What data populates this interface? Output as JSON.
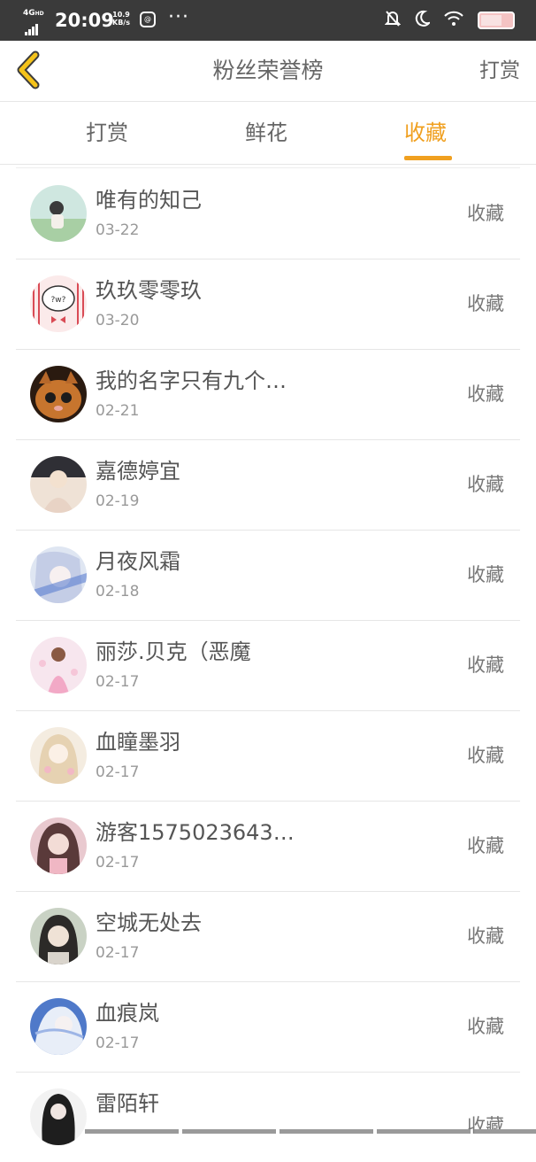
{
  "status_bar": {
    "network": "4G",
    "network_sub": "HD",
    "time": "20:09",
    "speed_value": "10.9",
    "speed_unit": "KB/s",
    "more": "···"
  },
  "header": {
    "title": "粉丝荣誉榜",
    "right_link": "打赏"
  },
  "tabs": [
    {
      "label": "打赏",
      "active": false
    },
    {
      "label": "鲜花",
      "active": false
    },
    {
      "label": "收藏",
      "active": true
    }
  ],
  "accent_color": "#f0a020",
  "list": [
    {
      "name": "唯有的知己",
      "date": "03-22",
      "action": "收藏"
    },
    {
      "name": "玖玖零零玖",
      "date": "03-20",
      "action": "收藏"
    },
    {
      "name": "我的名字只有九个…",
      "date": "02-21",
      "action": "收藏"
    },
    {
      "name": "嘉德婷宜",
      "date": "02-19",
      "action": "收藏"
    },
    {
      "name": "月夜风霜",
      "date": "02-18",
      "action": "收藏"
    },
    {
      "name": "丽莎.贝克（恶魔",
      "date": "02-17",
      "action": "收藏"
    },
    {
      "name": "血瞳墨羽",
      "date": "02-17",
      "action": "收藏"
    },
    {
      "name": "游客1575023643…",
      "date": "02-17",
      "action": "收藏"
    },
    {
      "name": "空城无处去",
      "date": "02-17",
      "action": "收藏"
    },
    {
      "name": "血痕岚",
      "date": "02-17",
      "action": "收藏"
    },
    {
      "name": "雷陌轩",
      "date": "",
      "action": "收藏"
    }
  ]
}
